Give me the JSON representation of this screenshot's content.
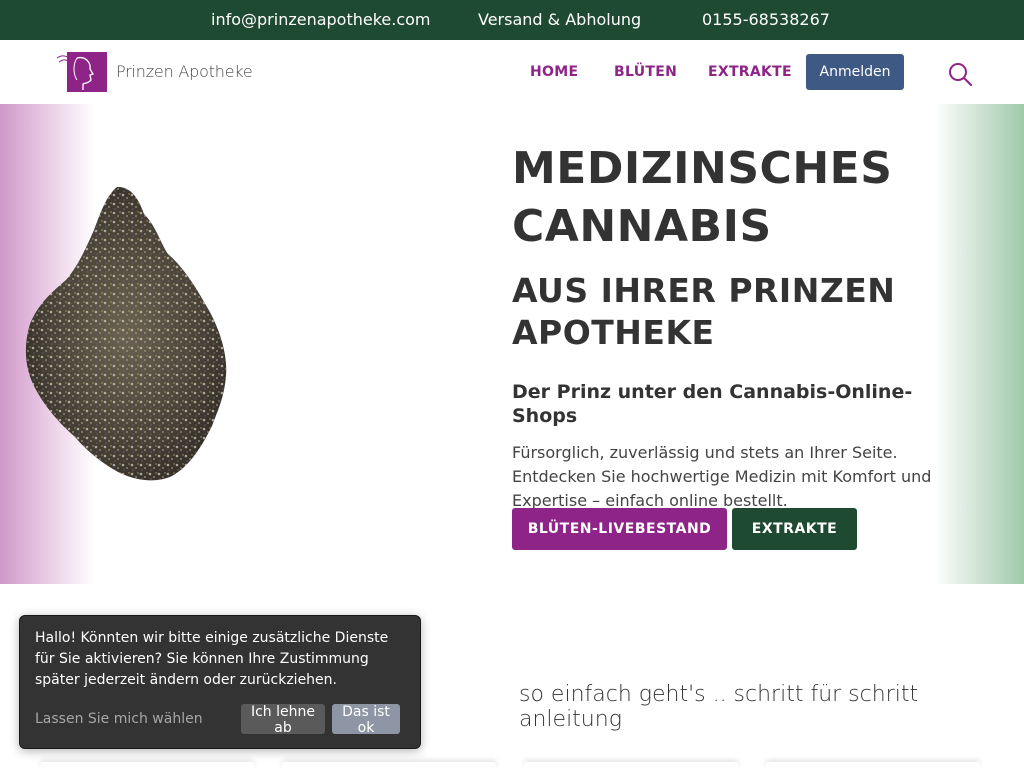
{
  "topbar": {
    "email": "info@prinzenapotheke.com",
    "shipping": "Versand & Abholung",
    "phone": "0155-68538267",
    "background": "#1f4a32"
  },
  "header": {
    "brand": "Prinzen Apotheke",
    "logo_icon": "prince-profile-logo",
    "nav": {
      "home": "HOME",
      "blueten": "BLÜTEN",
      "extrakte": "EXTRAKTE"
    },
    "login_label": "Anmelden",
    "search_icon": "search-icon"
  },
  "hero": {
    "title_line1": "MEDIZINSCHES",
    "title_line2": "CANNABIS",
    "subtitle_line1": "AUS IHRER PRINZEN",
    "subtitle_line2": "APOTHEKE",
    "tagline": "Der Prinz unter den Cannabis-Online-Shops",
    "description": "Fürsorglich, zuverlässig und stets an Ihrer Seite. Entdecken Sie hochwertige Medizin mit Komfort und Expertise – einfach online bestellt.",
    "btn_primary": "BLÜTEN-LIVEBESTAND",
    "btn_secondary": "EXTRAKTE"
  },
  "steps": {
    "title": "so einfach geht's .. schritt für schritt anleitung"
  },
  "cookie": {
    "text": "Hallo! Könnten wir bitte einige zusätzliche Dienste für Sie aktivieren? Sie können Ihre Zustimmung später jederzeit ändern oder zurückziehen.",
    "choose": "Lassen Sie mich wählen",
    "decline": "Ich lehne ab",
    "accept": "Das ist ok"
  },
  "colors": {
    "brand_purple": "#8e2488",
    "brand_green": "#1f4a32",
    "login_blue": "#3e5a84"
  }
}
